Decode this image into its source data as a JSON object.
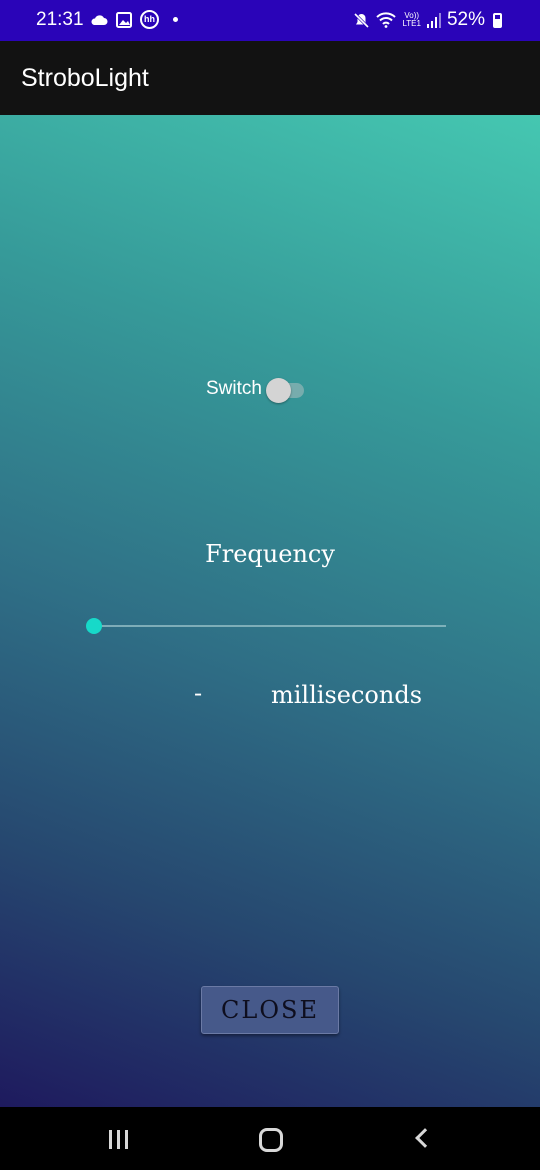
{
  "status_bar": {
    "time": "21:31",
    "battery": "52%",
    "volte_top": "Vo))",
    "volte_bottom": "LTE1",
    "icons_left": [
      "cloud-icon",
      "image-icon",
      "hh-icon",
      "dot-icon"
    ],
    "icons_right": [
      "mute-icon",
      "wifi-icon",
      "volte-icon",
      "signal-icon",
      "battery-icon"
    ],
    "background": "#2a04b8"
  },
  "app_bar": {
    "title": "StroboLight",
    "background": "#121212"
  },
  "main": {
    "switch": {
      "label": "Switch",
      "checked": false
    },
    "frequency_label": "Frequency",
    "slider": {
      "value_fraction": 0.0,
      "accent": "#17d9c9"
    },
    "frequency_value": "-",
    "unit_label": "milliseconds",
    "close_button": "CLOSE",
    "gradient": [
      "#45c7b1",
      "#369a99",
      "#2f6f86",
      "#26476f",
      "#1e1a5e"
    ]
  },
  "nav_bar": {
    "buttons": [
      "recent-apps-icon",
      "home-icon",
      "back-icon"
    ]
  }
}
